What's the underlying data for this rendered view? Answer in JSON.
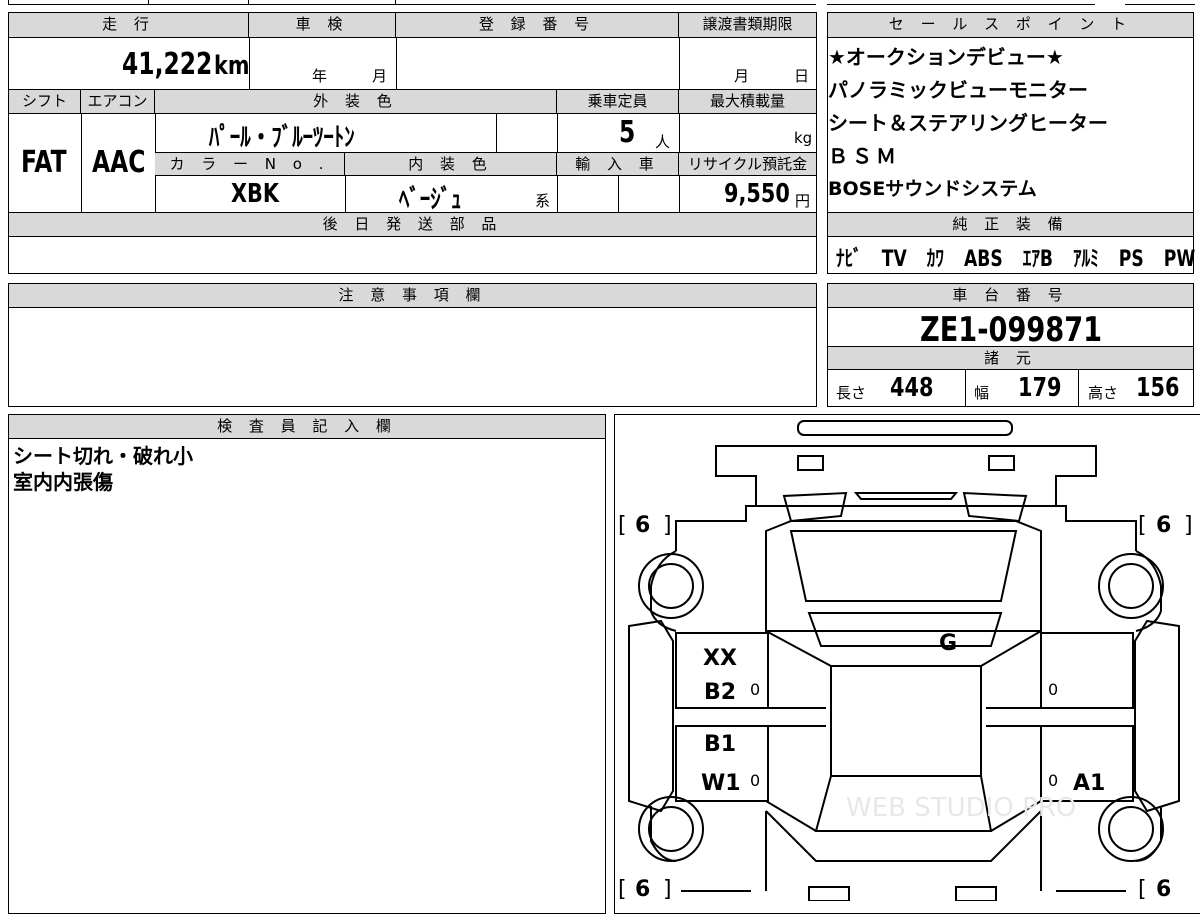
{
  "vehicle": {
    "mileage_header": "走 行",
    "mileage_value": "41,222",
    "mileage_unit": "km",
    "inspection_header": "車 検",
    "inspection_year_label": "年",
    "inspection_month_label": "月",
    "registration_header": "登 録 番 号",
    "transfer_header": "譲渡書類期限",
    "transfer_month_label": "月",
    "transfer_day_label": "日",
    "shift_header": "シフト",
    "shift_value": "FAT",
    "ac_header": "エアコン",
    "ac_value": "AAC",
    "exterior_header": "外 装 色",
    "exterior_value": "ﾊﾟｰﾙ・ﾌﾞﾙｰﾂｰﾄﾝ",
    "capacity_header": "乗車定員",
    "capacity_value": "5",
    "capacity_unit": "人",
    "load_header": "最大積載量",
    "load_unit": "kg",
    "color_no_header": "カ ラ ー N o .",
    "color_no_value": "XBK",
    "interior_header": "内 装 色",
    "interior_value": "ﾍﾞｰｼﾞｭ",
    "interior_suffix": "系",
    "import_header": "輸 入 車",
    "recycle_header": "リサイクル預託金",
    "recycle_value": "9,550",
    "recycle_unit": "円",
    "later_parts_header": "後 日 発 送 部 品"
  },
  "sales_points": {
    "header": "セ ー ル ス ポ イ ン ト",
    "items": [
      "★オークションデビュー★",
      "パノラミックビューモニター",
      "シート＆ステアリングヒーター",
      "ＢＳＭ",
      "BOSEサウンドシステム"
    ]
  },
  "equipment": {
    "header": "純 正 装 備",
    "items": [
      "ﾅﾋﾞ",
      "TV",
      "ｶﾜ",
      "ABS",
      "ｴｱB",
      "ｱﾙﾐ",
      "PS",
      "PW"
    ]
  },
  "notes": {
    "header": "注 意 事 項 欄"
  },
  "chassis": {
    "header": "車 台 番 号",
    "value": "ZE1-099871",
    "spec_header": "諸 元",
    "length_label": "長さ",
    "length_value": "448",
    "width_label": "幅",
    "width_value": "179",
    "height_label": "高さ",
    "height_value": "156"
  },
  "inspector": {
    "header": "検 査 員 記 入 欄",
    "lines": [
      "シート切れ・破れ小",
      "室内内張傷"
    ]
  },
  "diagram": {
    "tires": {
      "front_left": "6",
      "front_right": "6",
      "rear_left": "6",
      "rear_right": "6"
    },
    "marks": {
      "roof": "G",
      "left_front_1": "XX",
      "left_front_2": "B2",
      "left_rear_1": "B1",
      "left_rear_2": "W1",
      "right_rear": "A1"
    },
    "zeros": [
      "0",
      "0",
      "0",
      "0"
    ],
    "watermark": "WEB STUDIO PRO"
  }
}
